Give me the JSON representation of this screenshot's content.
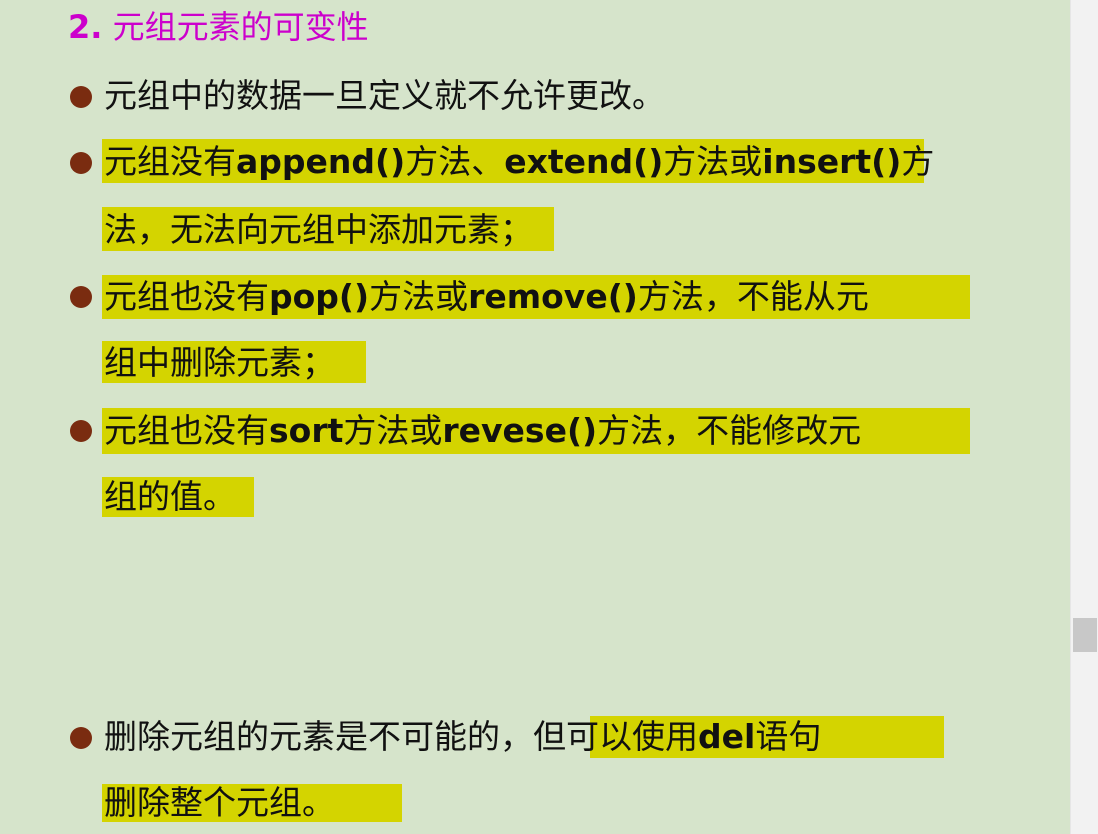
{
  "heading": {
    "number": "2.",
    "title": "元组元素的可变性"
  },
  "bullets": [
    {
      "lines": [
        {
          "segments": [
            "元组中的数据一旦定义就不允许更改。"
          ]
        }
      ]
    },
    {
      "lines": [
        {
          "segments": [
            "元组没有",
            "append()",
            "方法、",
            "extend()",
            "方法或",
            "insert()",
            "方"
          ]
        },
        {
          "segments": [
            "法，无法向元组中添加元素",
            "；"
          ]
        }
      ]
    },
    {
      "lines": [
        {
          "segments": [
            "元组也没有",
            "pop()",
            "方法或",
            "remove()",
            "方法，不能从元"
          ]
        },
        {
          "segments": [
            "组中删除元素；"
          ]
        }
      ]
    },
    {
      "lines": [
        {
          "segments": [
            "元组也没有",
            "sort",
            "方法或",
            "revese()",
            "方法，不能修改元"
          ]
        },
        {
          "segments": [
            "组的值。"
          ]
        }
      ]
    },
    {
      "lines": [
        {
          "segments": [
            "删除元组的元素是不可能的，",
            "但可以使用",
            "del",
            "语句"
          ]
        },
        {
          "segments": [
            "删除整个元组。"
          ]
        }
      ]
    }
  ],
  "colors": {
    "background": "#d6e4cb",
    "heading": "#cc00cc",
    "bullet": "#7a2c10",
    "highlight": "#d4d400",
    "text": "#111111"
  }
}
